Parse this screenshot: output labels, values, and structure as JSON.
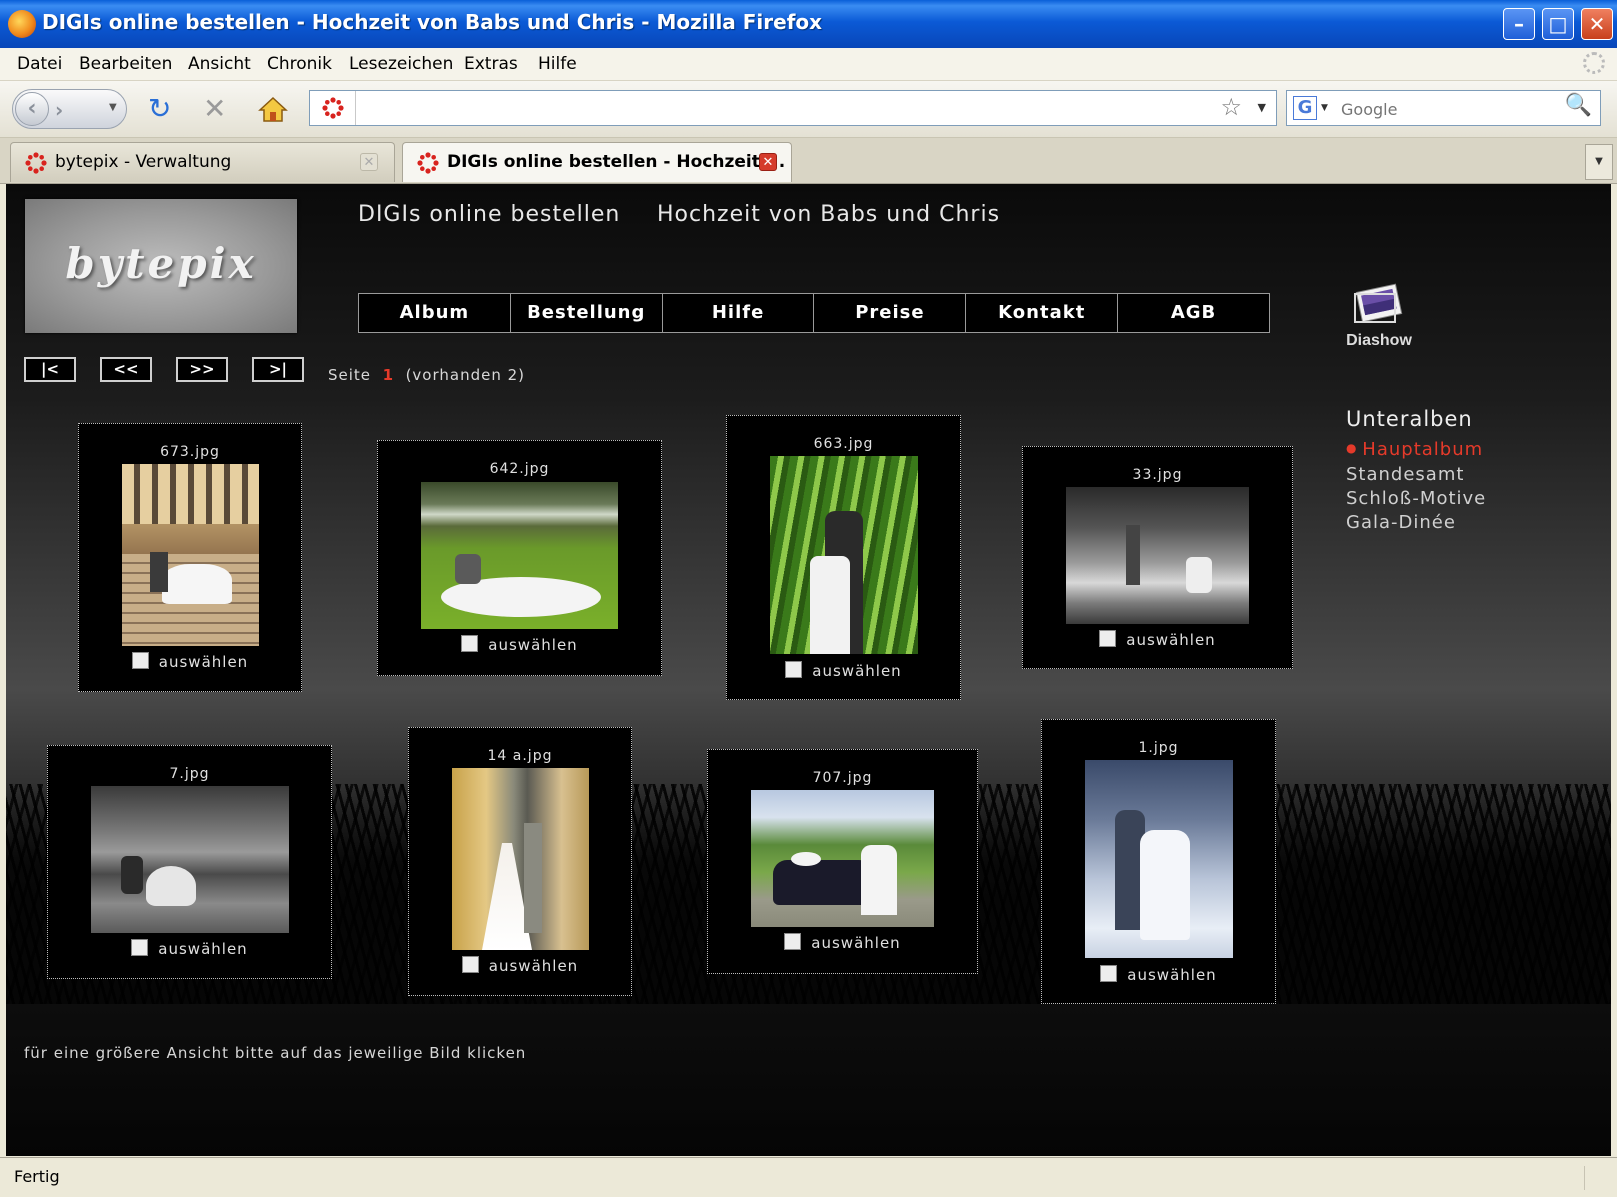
{
  "window": {
    "title": "DIGIs online bestellen - Hochzeit von Babs und Chris - Mozilla Firefox"
  },
  "menubar": [
    "Datei",
    "Bearbeiten",
    "Ansicht",
    "Chronik",
    "Lesezeichen",
    "Extras",
    "Hilfe"
  ],
  "toolbar": {
    "url": "",
    "search_placeholder": "Google"
  },
  "tabs": [
    {
      "label": "bytepix - Verwaltung",
      "active": false
    },
    {
      "label": "DIGIs online bestellen - Hochzeit ...",
      "active": true
    }
  ],
  "site": {
    "logo": "bytepix",
    "header": {
      "left": "DIGIs online bestellen",
      "right": "Hochzeit von Babs und Chris"
    },
    "nav": [
      "Album",
      "Bestellung",
      "Hilfe",
      "Preise",
      "Kontakt",
      "AGB"
    ],
    "diashow": "Diashow",
    "pager": {
      "first": "|<",
      "prev": "<<",
      "next": ">>",
      "last": ">|",
      "label": "Seite",
      "current": "1",
      "available": "(vorhanden 2)"
    },
    "subalbums": {
      "heading": "Unteralben",
      "items": [
        "Hauptalbum",
        "Standesamt",
        "Schloß-Motive",
        "Gala-Dinée"
      ],
      "active_index": 0
    },
    "select_label": "auswählen",
    "photos": [
      {
        "filename": "673.jpg",
        "selected": false
      },
      {
        "filename": "642.jpg",
        "selected": false
      },
      {
        "filename": "663.jpg",
        "selected": false
      },
      {
        "filename": "33.jpg",
        "selected": false
      },
      {
        "filename": "7.jpg",
        "selected": false
      },
      {
        "filename": "14 a.jpg",
        "selected": false
      },
      {
        "filename": "707.jpg",
        "selected": false
      },
      {
        "filename": "1.jpg",
        "selected": false
      }
    ],
    "hint": "für eine größere Ansicht bitte auf das jeweilige Bild klicken"
  },
  "status": {
    "text": "Fertig"
  },
  "colors": {
    "accent_red": "#e53a2a",
    "page_bg": "#0a0a0a",
    "titlebar_blue": "#0a5fd8"
  }
}
